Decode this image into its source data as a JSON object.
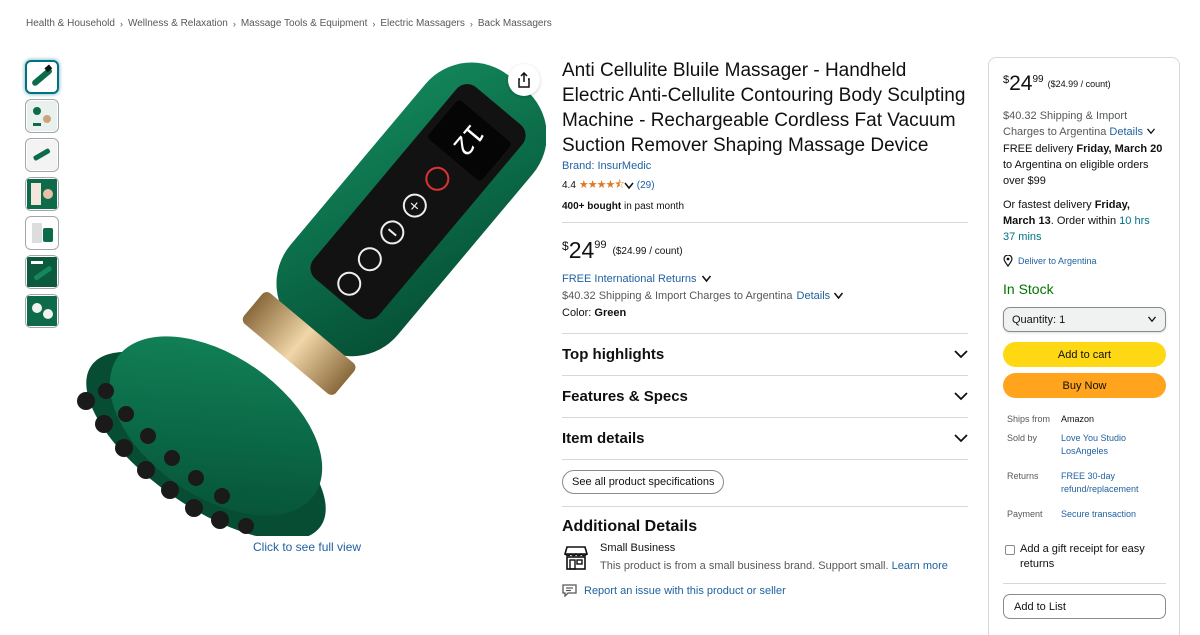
{
  "breadcrumb": [
    "Health & Household",
    "Wellness & Relaxation",
    "Massage Tools & Equipment",
    "Electric Massagers",
    "Back Massagers"
  ],
  "breadcrumb_sep": "›",
  "gallery": {
    "thumbnail_count": 7,
    "full_view_link": "Click to see full view",
    "device_display": "12"
  },
  "product": {
    "title": "Anti Cellulite Bluile Massager - Handheld Electric Anti-Cellulite Contouring Body Sculpting Machine - Rechargeable Cordless Fat Vacuum Suction Remover Shaping Massage Device",
    "brand": "Brand: InsurMedic",
    "rating_value": "4.4",
    "rating_stars": "★★★★⯪",
    "rating_count": "(29)",
    "bought_bold": "400+ bought",
    "bought_rest": " in past month",
    "price_symbol": "$",
    "price_whole": "24",
    "price_fraction": "99",
    "price_per_unit": "($24.99 / count)",
    "free_returns": "FREE International Returns",
    "shipping_text": "$40.32 Shipping & Import Charges to Argentina",
    "details_link": "Details",
    "color_label": "Color: ",
    "color_value": "Green"
  },
  "sections": {
    "top_highlights": "Top highlights",
    "features_specs": "Features & Specs",
    "item_details": "Item details",
    "see_all_specs": "See all product specifications",
    "additional_details": "Additional Details",
    "small_business_title": "Small Business",
    "small_business_text": "This product is from a small business brand. Support small.",
    "learn_more": "Learn more",
    "report_issue": "Report an issue with this product or seller"
  },
  "buybox": {
    "price_symbol": "$",
    "price_whole": "24",
    "price_fraction": "99",
    "price_per_unit": "($24.99 / count)",
    "shipping_line": "$40.32 Shipping & Import Charges to Argentina",
    "details_link": "Details",
    "free_delivery_pre": "FREE delivery ",
    "free_delivery_date": "Friday, March 20",
    "free_delivery_post": " to Argentina on eligible orders over $99",
    "fastest_pre": "Or fastest delivery ",
    "fastest_date": "Friday, March 13",
    "fastest_mid": ". Order within ",
    "fastest_time": "10 hrs 37 mins",
    "deliver_to": "Deliver to Argentina",
    "stock": "In Stock",
    "quantity": "Quantity: 1",
    "add_to_cart": "Add to cart",
    "buy_now": "Buy Now",
    "ships_from_label": "Ships from",
    "ships_from_value": "Amazon",
    "sold_by_label": "Sold by",
    "sold_by_value": "Love You Studio LosAngeles",
    "returns_label": "Returns",
    "returns_value": "FREE 30-day refund/replacement",
    "payment_label": "Payment",
    "payment_value": "Secure transaction",
    "gift_receipt": "Add a gift receipt for easy returns",
    "add_to_list": "Add to List"
  },
  "colors": {
    "link": "#2162a1",
    "star": "#de7921",
    "in_stock": "#007600",
    "cart_button": "#ffd814",
    "buy_button": "#ffa41c",
    "product_green": "#0e6b4a"
  }
}
